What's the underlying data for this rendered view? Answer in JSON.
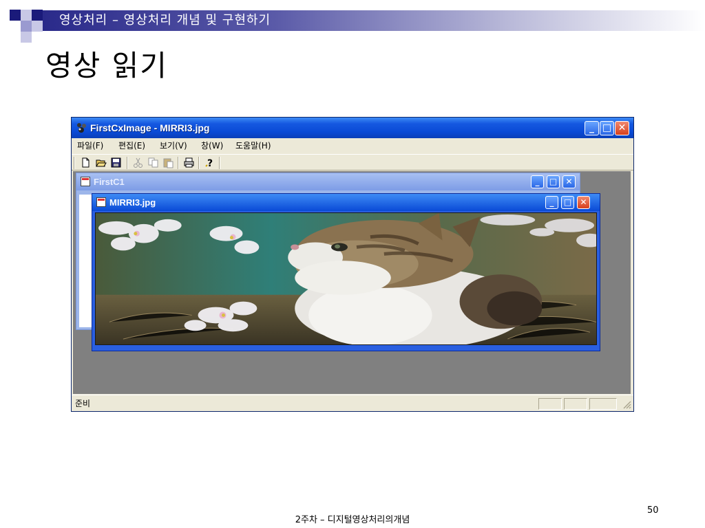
{
  "slide": {
    "header": "영상처리 – 영상처리 개념 및 구현하기",
    "title": "영상 읽기",
    "footer": "2주차 – 디지털영상처리의개념",
    "page_number": "50",
    "accent_colors": [
      "#1a1a7a",
      "#8a8ac8",
      "#b8b8d8"
    ]
  },
  "app": {
    "title": "FirstCxImage - MIRRI3.jpg",
    "menu": [
      "파일(F)",
      "편집(E)",
      "보기(V)",
      "창(W)",
      "도움말(H)"
    ],
    "toolbar": [
      {
        "icon": "new-file-icon",
        "glyph": "🗋",
        "enabled": true
      },
      {
        "icon": "open-folder-icon",
        "glyph": "📂",
        "enabled": true
      },
      {
        "icon": "save-icon",
        "glyph": "💾",
        "enabled": true
      },
      {
        "icon": "cut-icon",
        "glyph": "✂",
        "enabled": false
      },
      {
        "icon": "copy-icon",
        "glyph": "⧉",
        "enabled": false
      },
      {
        "icon": "paste-icon",
        "glyph": "📋",
        "enabled": false
      },
      {
        "icon": "print-icon",
        "glyph": "🖶",
        "enabled": true
      },
      {
        "icon": "help-icon",
        "glyph": "?",
        "enabled": true
      }
    ],
    "child_windows": [
      {
        "title": "FirstC1",
        "active": false
      },
      {
        "title": "MIRRI3.jpg",
        "active": true
      }
    ],
    "status": "준비",
    "window_buttons": {
      "minimize": "_",
      "maximize": "□",
      "close": "✕"
    }
  }
}
